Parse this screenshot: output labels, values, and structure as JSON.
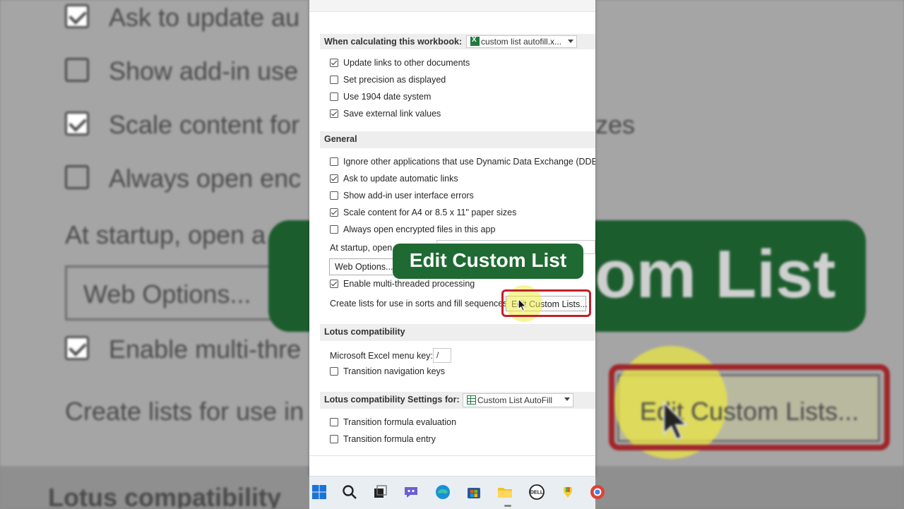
{
  "background": {
    "rows": [
      {
        "text": "Ask to update au",
        "checked": true
      },
      {
        "text": "Show add-in use",
        "checked": false
      },
      {
        "text": "Scale content for",
        "checked": true
      },
      {
        "text": "Always open enc",
        "checked": false
      }
    ],
    "right_sizes": "zes",
    "startup": "At startup, open a",
    "web_options": "Web Options...",
    "multi": "Enable multi-thre",
    "create": "Create lists for use in",
    "lotus": "Lotus compatibility",
    "banner_text": "om List",
    "button_text": "Edit Custom Lists..."
  },
  "dialog": {
    "calc_label": "When calculating this workbook:",
    "calc_value": "custom list autofill.x...",
    "calc_options": [
      {
        "label": "Update links to other documents",
        "checked": true
      },
      {
        "label": "Set precision as displayed",
        "checked": false
      },
      {
        "label": "Use 1904 date system",
        "checked": false
      },
      {
        "label": "Save external link values",
        "checked": true
      }
    ],
    "general_header": "General",
    "general_options": [
      {
        "label": "Ignore other applications that use Dynamic Data Exchange (DDE)",
        "checked": false
      },
      {
        "label": "Ask to update automatic links",
        "checked": true
      },
      {
        "label": "Show add-in user interface errors",
        "checked": false
      },
      {
        "label": "Scale content for A4 or 8.5 x 11\" paper sizes",
        "checked": true
      },
      {
        "label": "Always open encrypted files in this app",
        "checked": false
      }
    ],
    "startup_label": "At startup, open",
    "web_options": "Web Options...",
    "multithread_label": "Enable multi-threaded processing",
    "multithread_checked": true,
    "create_lists_label": "Create lists for use in sorts and fill sequences:",
    "edit_custom_lists": "Edit Custom Lists...",
    "lotus_header": "Lotus compatibility",
    "menu_key_label": "Microsoft Excel menu key:",
    "menu_key_value": "/",
    "transition_nav_label": "Transition navigation keys",
    "transition_nav_checked": false,
    "lotus_settings_label": "Lotus compatibility Settings for:",
    "lotus_settings_value": "Custom List AutoFill",
    "lotus_settings_options": [
      {
        "label": "Transition formula evaluation",
        "checked": false
      },
      {
        "label": "Transition formula entry",
        "checked": false
      }
    ]
  },
  "overlay": {
    "banner_text": "Edit Custom List",
    "banner_color": "#1e6a32",
    "highlight_color": "#c1212a"
  },
  "taskbar": {
    "icons": [
      "windows-start-icon",
      "search-icon",
      "task-view-icon",
      "teams-chat-icon",
      "edge-icon",
      "store-icon",
      "file-explorer-icon",
      "dell-icon",
      "app-icon",
      "chrome-icon"
    ]
  }
}
